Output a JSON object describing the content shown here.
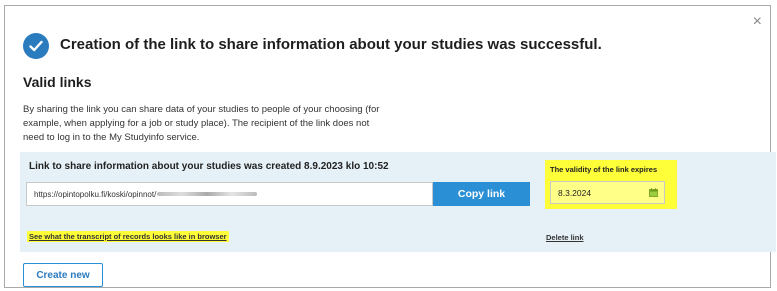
{
  "dialog": {
    "close_symbol": "×",
    "title": "Creation of the link to share information about your studies was successful.",
    "subtitle": "Valid links",
    "description": "By sharing the link you can share data of your studies to people of your choosing (for example, when applying for a job or study place). The recipient of the link does not need to log in to the My Studyinfo service."
  },
  "link_panel": {
    "created_text": "Link to share information about your studies was created 8.9.2023 klo 10:52",
    "url_value": "https://opintopolku.fi/koski/opinnot/",
    "copy_label": "Copy link",
    "validity_label": "The validity of the link expires",
    "validity_date": "8.3.2024",
    "transcript_link": "See what the transcript of records looks like in browser",
    "delete_link": "Delete link"
  },
  "actions": {
    "create_new": "Create new"
  },
  "icons": {
    "success": "checkmark-circle-icon",
    "close": "close-icon",
    "calendar": "calendar-icon"
  },
  "colors": {
    "accent": "#2b8fd6",
    "panel_background": "#e6f1f7",
    "highlight": "#ffff39"
  }
}
